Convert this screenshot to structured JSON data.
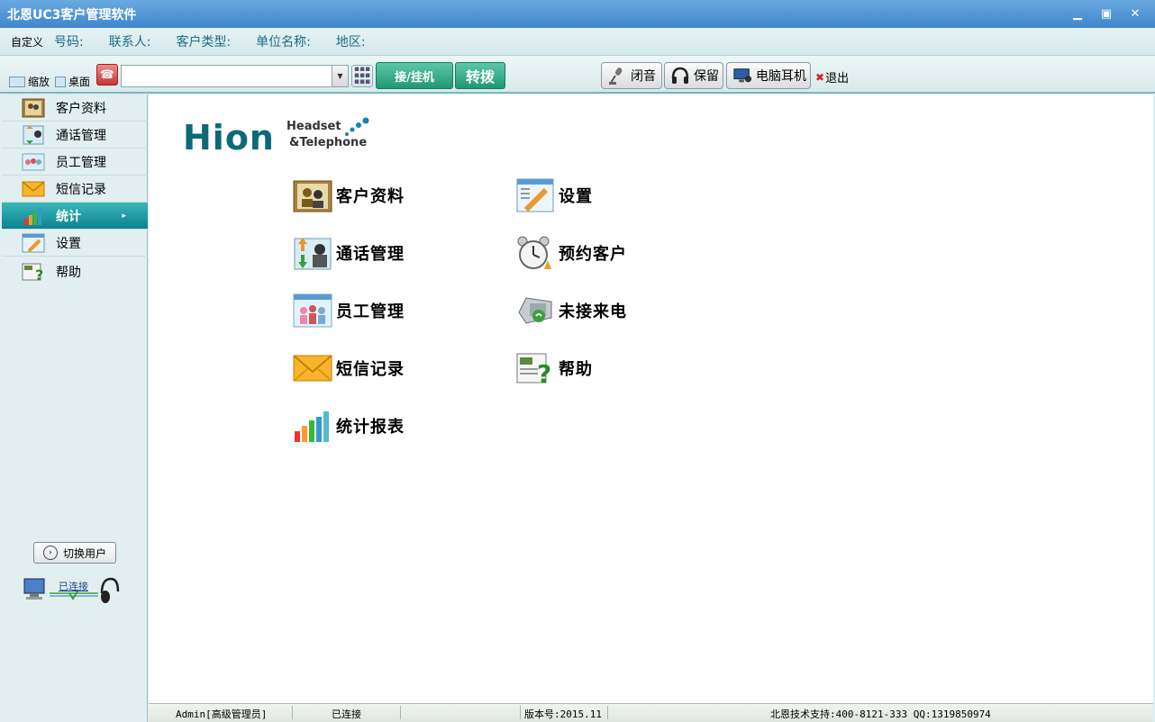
{
  "window": {
    "title": "北恩UC3客户管理软件"
  },
  "filter_bar": {
    "custom": "自定义",
    "labels": [
      "号码:",
      "联系人:",
      "客户类型:",
      "单位名称:",
      "地区:"
    ]
  },
  "toolbar": {
    "zoom": "缩放",
    "desktop": "桌面",
    "dial_placeholder": "",
    "answer_hangup": "接/挂机",
    "transfer": "转拨",
    "mute": "闭音",
    "hold": "保留",
    "pc_headset": "电脑耳机",
    "exit": "退出"
  },
  "sidebar": {
    "items": [
      {
        "label": "客户资料",
        "icon": "customer-info-icon"
      },
      {
        "label": "通话管理",
        "icon": "call-manage-icon"
      },
      {
        "label": "员工管理",
        "icon": "employee-icon"
      },
      {
        "label": "短信记录",
        "icon": "sms-icon"
      },
      {
        "label": "统计",
        "icon": "stats-icon",
        "active": true
      },
      {
        "label": "设置",
        "icon": "settings-icon"
      },
      {
        "label": "帮助",
        "icon": "help-icon"
      }
    ],
    "switch_user": "切换用户",
    "connection": "已连接"
  },
  "logo": {
    "brand": "Hion",
    "line1": "Headset",
    "line2": "&Telephone"
  },
  "main_menu": {
    "left": [
      "客户资料",
      "通话管理",
      "员工管理",
      "短信记录",
      "统计报表"
    ],
    "right": [
      "设置",
      "预约客户",
      "未接来电",
      "帮助"
    ]
  },
  "status_bar": {
    "user": "Admin[高级管理员]",
    "connection": "已连接",
    "version": "版本号:2015.11",
    "support": "北恩技术支持:400-8121-333 QQ:1319850974"
  },
  "colors": {
    "title_bar": "#3f86cc",
    "active_nav": "#0c8290",
    "accent_green": "#1f9872"
  }
}
